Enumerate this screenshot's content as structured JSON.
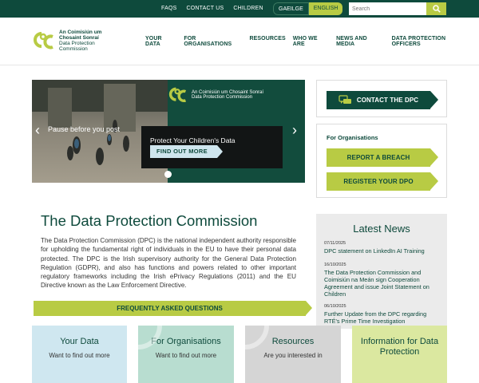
{
  "top_links": [
    "FAQS",
    "CONTACT US",
    "CHILDREN"
  ],
  "languages": {
    "ga": "GAEILGE",
    "en": "ENGLISH"
  },
  "search": {
    "placeholder": "Search"
  },
  "logo": {
    "line1": "An Coimisiún um",
    "line2": "Chosaint Sonraí",
    "line3": "Data Protection",
    "line4": "Commission"
  },
  "nav": [
    "YOUR DATA",
    "FOR ORGANISATIONS",
    "RESOURCES",
    "WHO WE ARE",
    "NEWS AND MEDIA",
    "DATA PROTECTION OFFICERS"
  ],
  "hero": {
    "logo_line1": "An Coimisiún um Chosaint Sonraí",
    "logo_line2": "Data Protection Commission",
    "pause_text": "Pause before you post",
    "promo_title": "Protect Your Children's Data",
    "promo_button": "FIND OUT MORE",
    "prev_arrow": "‹",
    "next_arrow": "›"
  },
  "contact": {
    "label": "CONTACT THE DPC"
  },
  "for_orgs": {
    "heading": "For Organisations",
    "report": "REPORT A BREACH",
    "register": "REGISTER YOUR DPO"
  },
  "main": {
    "title": "The Data Protection Commission",
    "paragraph": "The Data Protection Commission (DPC) is the national independent authority responsible for upholding the fundamental right of individuals in the EU to have their personal data protected. The DPC is the Irish supervisory authority for the General Data Protection Regulation (GDPR), and also has functions and powers related to other important regulatory frameworks including the Irish ePrivacy Regulations (2011) and the EU Directive known as the Law Enforcement Directive.",
    "faq_button": "FREQUENTLY ASKED QUESTIONS"
  },
  "news": {
    "heading": "Latest News",
    "items": [
      {
        "date": "07/11/2025",
        "title": "DPC statement on LinkedIn AI Training"
      },
      {
        "date": "16/10/2025",
        "title": "The Data Protection Commission and Coimisiún na Meán sign Cooperation Agreement and issue Joint Statement on Children"
      },
      {
        "date": "06/10/2025",
        "title": "Further Update from the DPC regarding RTÉ's Prime Time Investigation"
      }
    ]
  },
  "tiles": [
    {
      "title": "Your Data",
      "sub": "Want to find out more"
    },
    {
      "title": "For Organisations",
      "sub": "Want to find out more"
    },
    {
      "title": "Resources",
      "sub": "Are you interested in"
    },
    {
      "title": "Information for Data Protection",
      "sub": ""
    }
  ],
  "colors": {
    "dark_green": "#0e4a3c",
    "lime": "#b8cb44",
    "light_blue": "#cfe7f0"
  }
}
